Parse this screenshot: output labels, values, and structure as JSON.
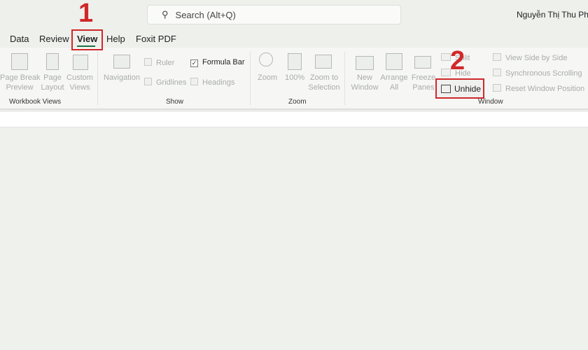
{
  "search": {
    "placeholder": "Search (Alt+Q)",
    "icon": "search-icon"
  },
  "user": {
    "name": "Nguyễn Thị Thu Phươ"
  },
  "tabs": [
    "Data",
    "Review",
    "View",
    "Help",
    "Foxit PDF"
  ],
  "active_tab": "View",
  "groups": {
    "workbook_views": {
      "label": "Workbook Views",
      "items": [
        "Page Break\nPreview",
        "Page\nLayout",
        "Custom\nViews"
      ]
    },
    "show": {
      "label": "Show",
      "navigation": "Navigation",
      "ruler": "Ruler",
      "gridlines": "Gridlines",
      "formula_bar": "Formula Bar",
      "headings": "Headings",
      "formula_bar_checked": true
    },
    "zoom": {
      "label": "Zoom",
      "items": [
        "Zoom",
        "100%",
        "Zoom to\nSelection"
      ]
    },
    "window": {
      "label": "Window",
      "new_window": "New\nWindow",
      "arrange_all": "Arrange\nAll",
      "freeze_panes": "Freeze\nPanes",
      "split": "Split",
      "hide": "Hide",
      "unhide": "Unhide",
      "view_side": "View Side by Side",
      "sync_scroll": "Synchronous Scrolling",
      "reset_pos": "Reset Window Position"
    }
  },
  "annotations": {
    "step1": "1",
    "step2": "2",
    "color": "#d0282a"
  },
  "colors": {
    "accent": "#1e7145"
  }
}
